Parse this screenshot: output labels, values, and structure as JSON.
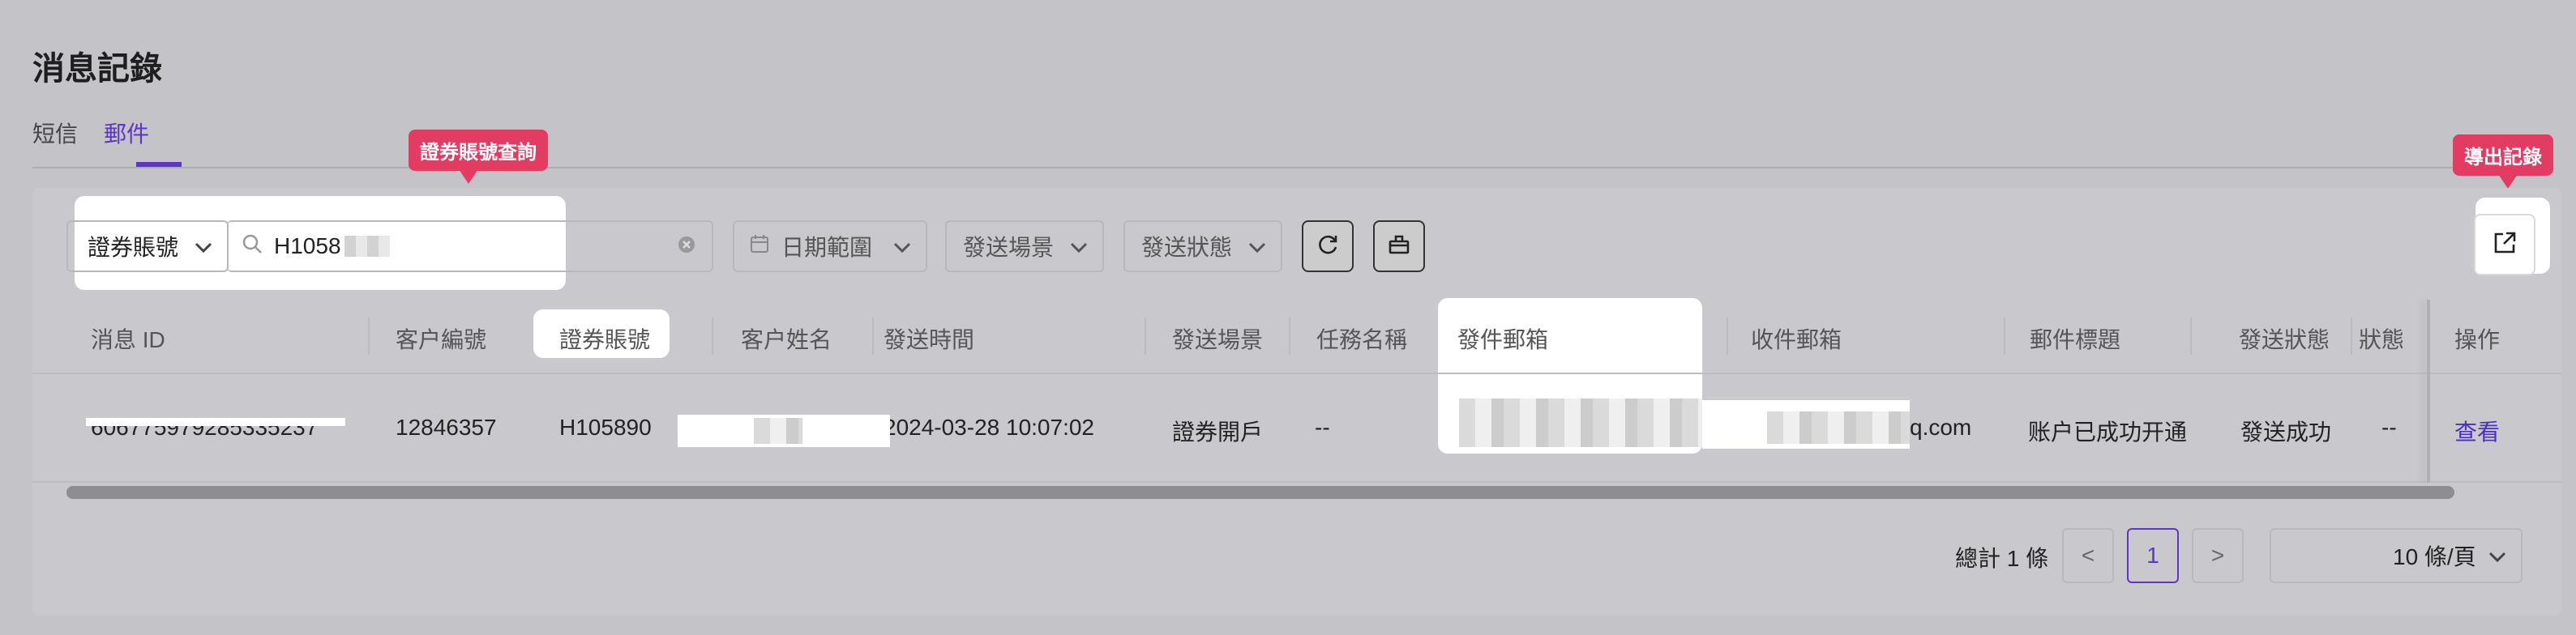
{
  "page": {
    "title": "消息記錄"
  },
  "tabs": [
    {
      "label": "短信",
      "active": false
    },
    {
      "label": "郵件",
      "active": true
    }
  ],
  "callouts": {
    "account_search": "證券賬號查詢",
    "export": "導出記錄"
  },
  "filters": {
    "field_select": "證券賬號",
    "search_value": "H1058",
    "date_range_placeholder": "日期範圍",
    "scene_placeholder": "發送場景",
    "status_placeholder": "發送狀態"
  },
  "icons": {
    "search": "search-icon",
    "clear": "clear-icon",
    "calendar": "calendar-icon",
    "refresh": "refresh-icon",
    "reset": "reset-icon",
    "export": "export-icon",
    "chevron": "chevron-down-icon"
  },
  "table": {
    "columns": [
      "消息 ID",
      "客户編號",
      "證券賬號",
      "客户姓名",
      "發送時間",
      "發送場景",
      "任務名稱",
      "發件郵箱",
      "收件郵箱",
      "郵件標題",
      "發送狀態",
      "狀態",
      "操作"
    ],
    "row": {
      "message_id": "606775979285335237",
      "customer_no": "12846357",
      "account": "H105890",
      "send_time": "2024-03-28 10:07:02",
      "scene": "證券開戶",
      "task": "--",
      "recipient_suffix": "q.com",
      "subject": "账户已成功开通",
      "status": "發送成功",
      "state": "--",
      "action": "查看"
    }
  },
  "pagination": {
    "total_text": "總計 1 條",
    "prev": "<",
    "current": "1",
    "next": ">",
    "page_size": "10 條/頁"
  },
  "colors": {
    "accent": "#5b36c8",
    "callout": "#e23c62",
    "background": "#c4c3c7"
  }
}
